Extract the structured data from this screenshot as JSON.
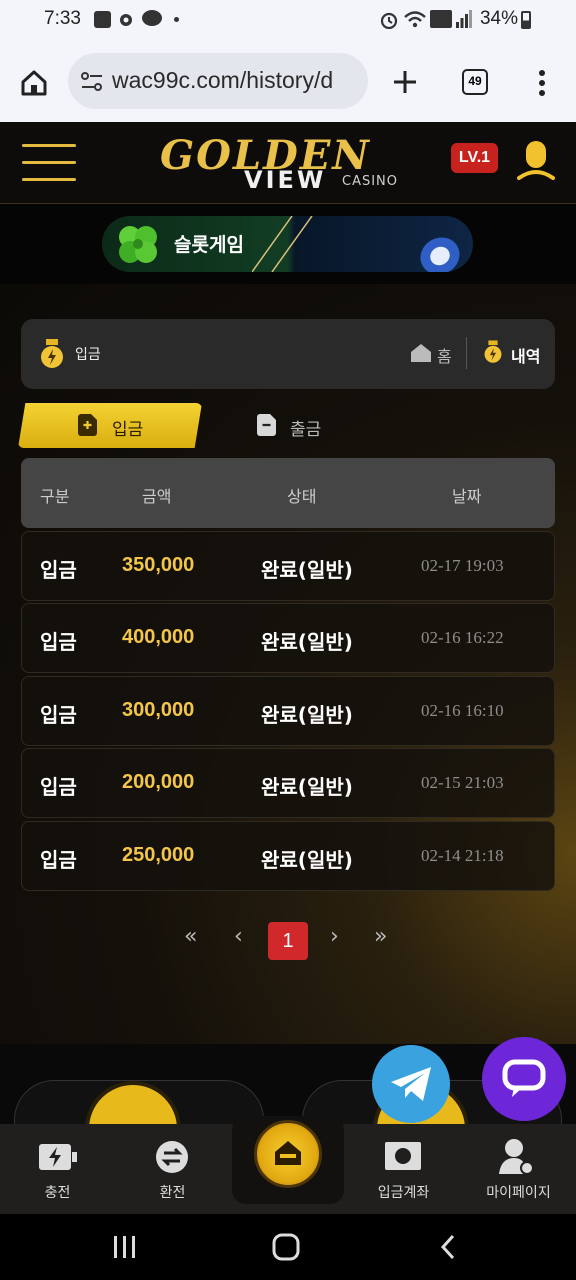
{
  "status_bar": {
    "time": "7:33",
    "battery": "34%"
  },
  "browser": {
    "url": "wac99c.com/history/d",
    "tab_count": "49"
  },
  "header": {
    "logo_word1": "GOLDEN",
    "logo_word2": "VIEW",
    "logo_word3": "CASINO",
    "level_badge": "LV.1",
    "accent": "#e2bb3f"
  },
  "banner": {
    "label": "슬롯게임"
  },
  "breadcrumb": {
    "current": "입금",
    "home": "홈",
    "history": "내역"
  },
  "tabs": [
    {
      "label": "입금",
      "active": true
    },
    {
      "label": "출금",
      "active": false
    }
  ],
  "table": {
    "headers": [
      "구분",
      "금액",
      "상태",
      "날짜"
    ],
    "rows": [
      {
        "type": "입금",
        "amount": "350,000",
        "status": "완료(일반)",
        "date": "02-17 19:03"
      },
      {
        "type": "입금",
        "amount": "400,000",
        "status": "완료(일반)",
        "date": "02-16 16:22"
      },
      {
        "type": "입금",
        "amount": "300,000",
        "status": "완료(일반)",
        "date": "02-16 16:10"
      },
      {
        "type": "입금",
        "amount": "200,000",
        "status": "완료(일반)",
        "date": "02-15 21:03"
      },
      {
        "type": "입금",
        "amount": "250,000",
        "status": "완료(일반)",
        "date": "02-14 21:18"
      }
    ]
  },
  "pagination": {
    "first": "«",
    "prev": "‹",
    "current": "1",
    "next": "›",
    "last": "»"
  },
  "bottom_nav": {
    "charge": "충전",
    "exchange": "환전",
    "deposit_account": "입금계좌",
    "mypage": "마이페이지"
  }
}
